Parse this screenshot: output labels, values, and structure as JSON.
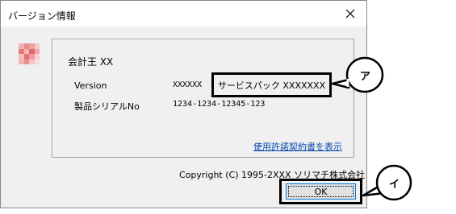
{
  "window": {
    "title": "バージョン情報"
  },
  "product": {
    "name": "会計王 XX"
  },
  "version": {
    "label": "Version",
    "value": "XXXXXX",
    "service_pack": "サービスパック XXXXXXX"
  },
  "serial": {
    "label": "製品シリアルNo",
    "value": "1234-1234-12345-123"
  },
  "license_link": "使用許諾契約書を表示",
  "copyright": "Copyright (C) 1995-2XXX ソリマチ株式会社",
  "ok_button": "OK",
  "callouts": {
    "a": "ア",
    "b": "イ"
  },
  "colors": {
    "link": "#0645ad",
    "dialog_bg": "#f0f0f0",
    "ok_border": "#0078d7"
  }
}
